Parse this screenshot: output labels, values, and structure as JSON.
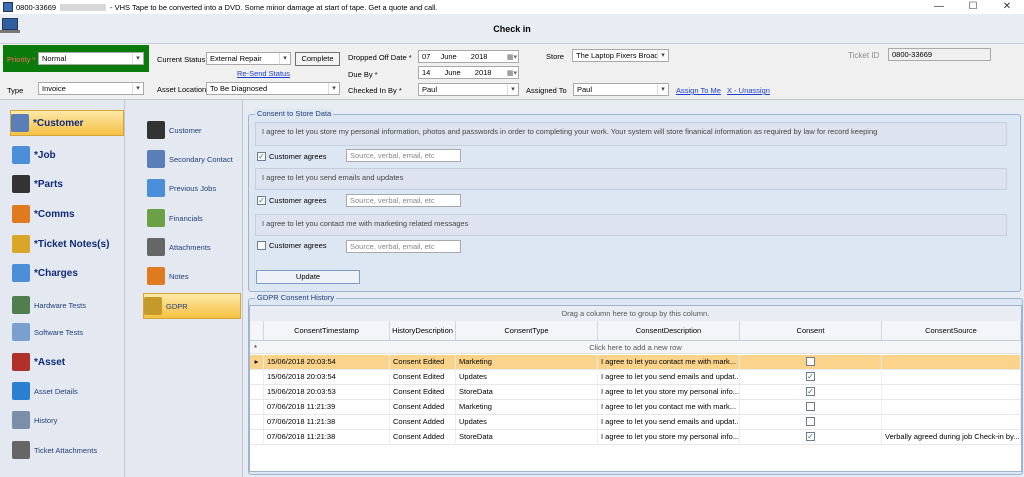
{
  "window": {
    "ticket_prefix": "0800-33669",
    "caption": "- VHS Tape to be converted into a DVD.  Some minor damage at start of tape.  Get a quote and call.",
    "title": "Check in",
    "min": "—",
    "max": "☐",
    "close": "✕"
  },
  "form": {
    "priority_label": "Priority *",
    "priority_value": "Normal",
    "type_label": "Type",
    "type_value": "Invoice",
    "current_status_label": "Current Status",
    "current_status_value": "External Repair",
    "complete_button": "Complete",
    "resend_status_link": "Re-Send Status",
    "asset_location_label": "Asset Location",
    "asset_location_value": "To Be Diagnosed",
    "dropped_off_label": "Dropped Off Date *",
    "dropped_off_day": "07",
    "dropped_off_month": "June",
    "dropped_off_year": "2018",
    "due_by_label": "Due By *",
    "due_by_day": "14",
    "due_by_month": "June",
    "due_by_year": "2018",
    "checked_in_by_label": "Checked In By *",
    "checked_in_by_value": "Paul",
    "store_label": "Store",
    "store_value": "The Laptop Fixers Broad",
    "assigned_to_label": "Assigned To",
    "assigned_to_value": "Paul",
    "assign_to_me_link": "Assign To Me",
    "unassign_link": "X - Unassign",
    "ticket_id_label": "Ticket ID",
    "ticket_id_value": "0800-33669"
  },
  "nav_primary": [
    {
      "label": "*Customer",
      "icon": "customer-icon",
      "color": "#5a7fb8"
    },
    {
      "label": "*Job",
      "icon": "monitor-icon",
      "color": "#4a8fd8"
    },
    {
      "label": "*Parts",
      "icon": "list-icon",
      "color": "#333333"
    },
    {
      "label": "*Comms",
      "icon": "pencil-icon",
      "color": "#e07a1f"
    },
    {
      "label": "*Ticket Notes(s)",
      "icon": "warning-note-icon",
      "color": "#d9a627"
    },
    {
      "label": "*Charges",
      "icon": "document-icon",
      "color": "#4a8fd8"
    },
    {
      "label": "Hardware Tests",
      "icon": "hardware-icon",
      "color": "#4f7f4f"
    },
    {
      "label": "Software Tests",
      "icon": "software-icon",
      "color": "#7aa0d0"
    },
    {
      "label": "*Asset",
      "icon": "asset-icon",
      "color": "#b0302a"
    },
    {
      "label": "Asset Details",
      "icon": "help-icon",
      "color": "#2a7fd0"
    },
    {
      "label": "History",
      "icon": "history-icon",
      "color": "#7c8fa8"
    },
    {
      "label": "Ticket Attachments",
      "icon": "paperclip-icon",
      "color": "#666666"
    }
  ],
  "nav_secondary": [
    {
      "label": "Customer",
      "icon": "person-icon",
      "color": "#333333"
    },
    {
      "label": "Secondary Contact",
      "icon": "contacts-icon",
      "color": "#5a7fb8"
    },
    {
      "label": "Previous Jobs",
      "icon": "jobs-icon",
      "color": "#4a8fd8"
    },
    {
      "label": "Financials",
      "icon": "money-icon",
      "color": "#6aa046"
    },
    {
      "label": "Attachments",
      "icon": "paperclip-icon",
      "color": "#666666"
    },
    {
      "label": "Notes",
      "icon": "note-icon",
      "color": "#e07a1f"
    },
    {
      "label": "GDPR",
      "icon": "lock-icon",
      "color": "#c49a2a"
    }
  ],
  "consent": {
    "title": "Consent to Store Data",
    "text1": "I agree to let you store my personal information, photos and passwords in order to completing your work. Your system will store finanical information as required by law for record keeping",
    "text2": "I agree to let you send emails and updates",
    "text3": "I agree to let you contact me with marketing related messages",
    "agree_label": "Customer agrees",
    "source_placeholder": "Source, verbal, email, etc",
    "update_button": "Update",
    "checked": [
      true,
      true,
      false
    ]
  },
  "history": {
    "title": "GDPR Consent History",
    "group_hint": "Drag a column here to group by this column.",
    "new_row_hint": "Click here to add a new row",
    "columns": [
      "ConsentTimestamp",
      "HistoryDescription",
      "ConsentType",
      "ConsentDescription",
      "Consent",
      "ConsentSource"
    ],
    "rows": [
      {
        "ts": "15/06/2018 20:03:54",
        "hd": "Consent Edited",
        "ct": "Marketing",
        "cd": "I agree to let you contact me with mark...",
        "c": false,
        "cs": ""
      },
      {
        "ts": "15/06/2018 20:03:54",
        "hd": "Consent Edited",
        "ct": "Updates",
        "cd": "I agree to let you send emails and updat...",
        "c": true,
        "cs": ""
      },
      {
        "ts": "15/06/2018 20:03:53",
        "hd": "Consent Edited",
        "ct": "StoreData",
        "cd": "I agree to let you store my personal info...",
        "c": true,
        "cs": ""
      },
      {
        "ts": "07/06/2018 11:21:39",
        "hd": "Consent Added",
        "ct": "Marketing",
        "cd": "I agree to let you contact me with mark...",
        "c": false,
        "cs": ""
      },
      {
        "ts": "07/06/2018 11:21:38",
        "hd": "Consent Added",
        "ct": "Updates",
        "cd": "I agree to let you send emails and updat...",
        "c": false,
        "cs": ""
      },
      {
        "ts": "07/06/2018 11:21:38",
        "hd": "Consent Added",
        "ct": "StoreData",
        "cd": "I agree to let you store my personal info...",
        "c": true,
        "cs": "Verbally agreed during job Check-in by..."
      }
    ]
  }
}
